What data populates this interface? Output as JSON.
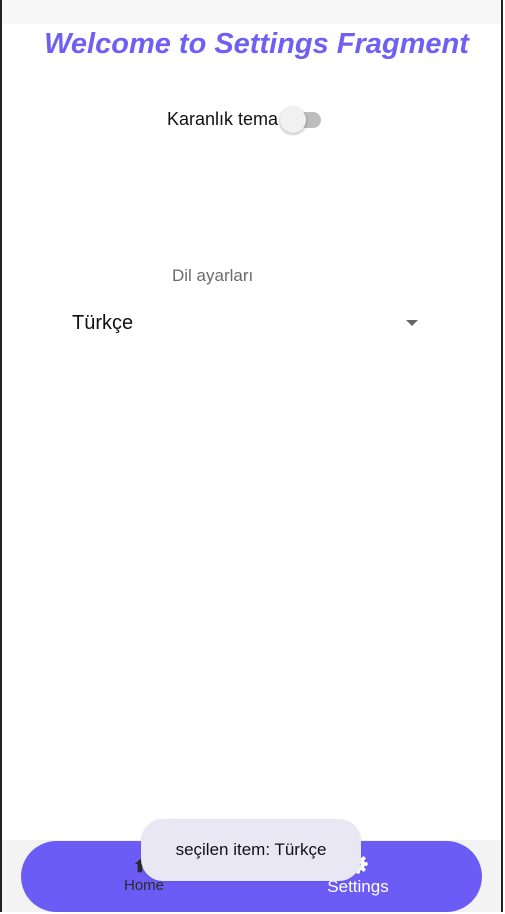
{
  "title": "Welcome to Settings Fragment",
  "theme": {
    "label": "Karanlık tema",
    "enabled": false
  },
  "language": {
    "label": "Dil ayarları",
    "selected": "Türkçe"
  },
  "bottom_nav": {
    "items": [
      {
        "label": "Home",
        "icon": "home-icon"
      },
      {
        "label": "Settings",
        "icon": "gear-icon"
      }
    ],
    "active": "Settings"
  },
  "toast": {
    "text": "seçilen item: Türkçe"
  },
  "colors": {
    "accent": "#6b5cf6",
    "title": "#6f5ff2",
    "toast_bg": "#e8e7f3"
  }
}
